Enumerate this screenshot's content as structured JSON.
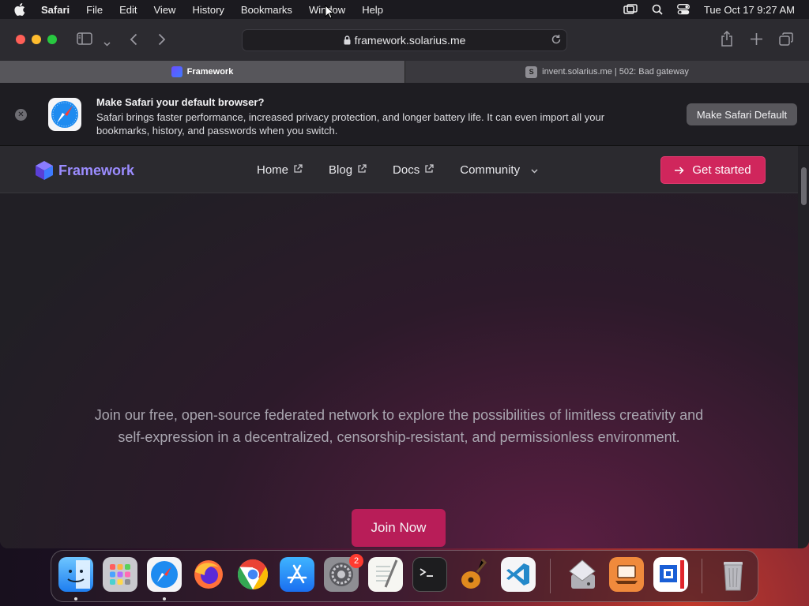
{
  "menubar": {
    "app": "Safari",
    "items": [
      "File",
      "Edit",
      "View",
      "History",
      "Bookmarks",
      "Window",
      "Help"
    ],
    "clock": "Tue Oct 17  9:27 AM"
  },
  "browser": {
    "url": "framework.solarius.me",
    "tabs": [
      {
        "label": "Framework",
        "favicon": "framework-favicon"
      },
      {
        "label": "invent.solarius.me | 502: Bad gateway",
        "favicon": "S"
      }
    ]
  },
  "banner": {
    "title": "Make Safari your default browser?",
    "description": "Safari brings faster performance, increased privacy protection, and longer battery life. It can even import all your bookmarks, history, and passwords when you switch.",
    "button": "Make Safari Default"
  },
  "site": {
    "brand": "Framework",
    "nav": [
      {
        "label": "Home",
        "icon": "external-link-icon"
      },
      {
        "label": "Blog",
        "icon": "external-link-icon"
      },
      {
        "label": "Docs",
        "icon": "external-link-icon"
      },
      {
        "label": "Community",
        "icon": "chevron-down-icon"
      }
    ],
    "cta": "Get started",
    "hero_text": "Join our free, open-source federated network to explore the possibilities of limitless creativity and self-expression in a decentralized, censorship-resistant, and permissionless environment.",
    "join_button": "Join Now"
  },
  "dock": {
    "apps": [
      "Finder",
      "Launchpad",
      "Safari",
      "Firefox",
      "Chrome",
      "App Store",
      "System Settings",
      "TextEdit",
      "Terminal",
      "GarageBand",
      "Visual Studio Code",
      "Disk Utility",
      "Remote Desktop",
      "Parallels",
      "Trash"
    ],
    "settings_badge": "2"
  },
  "colors": {
    "brand": "#9b8cff",
    "cta": "#d0265c",
    "join": "#b81d58"
  }
}
